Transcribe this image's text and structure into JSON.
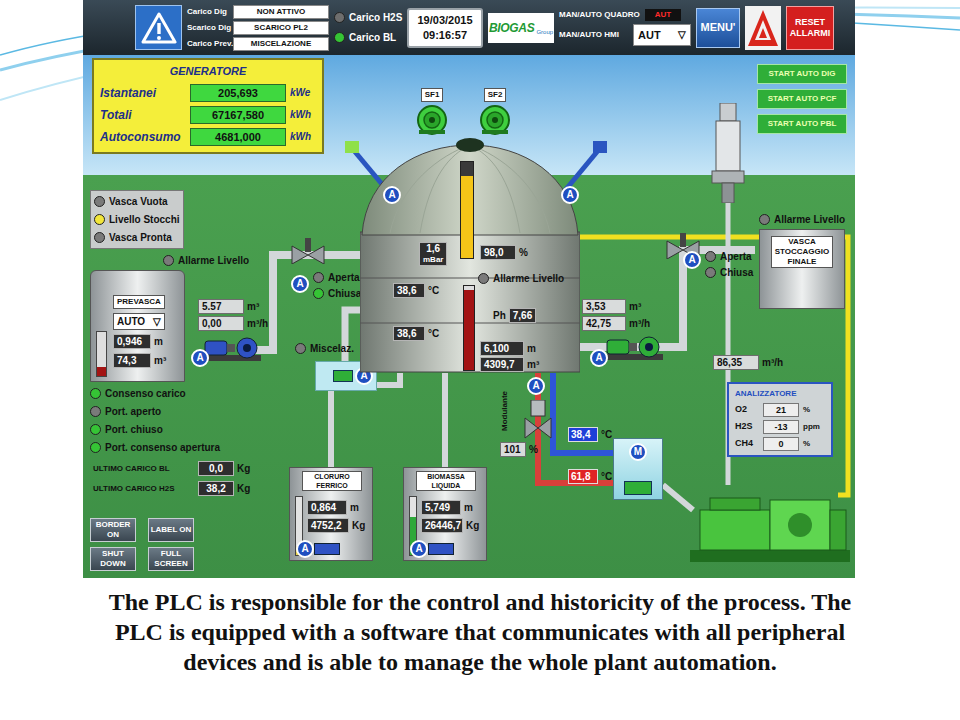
{
  "header": {
    "status_rows": [
      {
        "label": "Carico Dig",
        "value": "NON ATTIVO"
      },
      {
        "label": "Scarico Dig",
        "value": "SCARICO PL2"
      },
      {
        "label": "Carico Prev.",
        "value": "MISCELAZIONE"
      }
    ],
    "indicators": [
      {
        "label": "Carico H2S",
        "color": "#6e6e6e"
      },
      {
        "label": "Carico BL",
        "color": "#35c435"
      }
    ],
    "date": "19/03/2015",
    "time": "09:16:57",
    "logo": {
      "main": "BIOGAS",
      "sub": "Group"
    },
    "quadro": {
      "label": "MAN/AUTO QUADRO",
      "value": "AUT"
    },
    "hmi": {
      "label": "MAN/AUTO HMI",
      "value": "AUT",
      "arrow": "▽"
    },
    "menu": "MENU'",
    "reset": "RESET ALLARMI"
  },
  "generator": {
    "title": "GENERATORE",
    "rows": [
      {
        "label": "Istantanei",
        "value": "205,693",
        "unit": "kWe"
      },
      {
        "label": "Totali",
        "value": "67167,580",
        "unit": "kWh"
      },
      {
        "label": "Autoconsumo",
        "value": "4681,000",
        "unit": "kWh"
      }
    ]
  },
  "start_buttons": [
    "START AUTO DIG",
    "START AUTO PCF",
    "START AUTO PBL"
  ],
  "tank_status": [
    {
      "label": "Vasca Vuota",
      "color": "#7a7a7a"
    },
    {
      "label": "Livello Stocchi",
      "color": "#f2e63a"
    },
    {
      "label": "Vasca Pronta",
      "color": "#7a7a7a"
    }
  ],
  "prevasca": {
    "alarm": {
      "label": "Allarme Livello",
      "color": "#7a7a7a"
    },
    "name": "PREVASCA",
    "mode": "AUTO",
    "mode_arrow": "▽",
    "volume": {
      "value": "5.57",
      "unit": "m³"
    },
    "flow": {
      "value": "0,00",
      "unit": "m³/h"
    },
    "height": {
      "value": "0,946",
      "unit": "m"
    },
    "contents": {
      "value": "74,3",
      "unit": "m³"
    },
    "level": 0.2,
    "pump_badge": "A"
  },
  "inlet_valve": {
    "badge": "A",
    "states": [
      {
        "label": "Aperta",
        "color": "#7a7a7a"
      },
      {
        "label": "Chiusa",
        "color": "#35c435"
      }
    ]
  },
  "mixer": {
    "label": "Miscelaz.",
    "color": "#7a7a7a",
    "badge": "A"
  },
  "digester": {
    "fans": [
      "SF1",
      "SF2"
    ],
    "agitator_badges": [
      "A",
      "A"
    ],
    "pressure": {
      "value": "1,6",
      "unit": "mBar"
    },
    "gas": {
      "value": "98,0",
      "unit": "%"
    },
    "gas_level": 0.85,
    "temperatures": [
      {
        "value": "38,6",
        "unit": "°C"
      },
      {
        "value": "38,6",
        "unit": "°C"
      }
    ],
    "alarm": {
      "label": "Allarme Livello",
      "color": "#7a7a7a"
    },
    "ph": {
      "label": "Ph",
      "value": "7,66"
    },
    "height": {
      "value": "6,100",
      "unit": "m"
    },
    "contents": {
      "value": "4309,7",
      "unit": "m³"
    },
    "liquid_level": 0.95
  },
  "outlet": {
    "volume": {
      "value": "3,53",
      "unit": "m³"
    },
    "flow": {
      "value": "42,75",
      "unit": "m³/h"
    },
    "pump_badge": "A"
  },
  "storage_valve": {
    "badge": "A",
    "states": [
      {
        "label": "Aperta",
        "color": "#7a7a7a"
      },
      {
        "label": "Chiusa",
        "color": "#7a7a7a"
      }
    ]
  },
  "storage": {
    "alarm": {
      "label": "Allarme Livello",
      "color": "#7a7a7a"
    },
    "name": "VASCA STOCCAGGIO FINALE"
  },
  "gas_flow": {
    "value": "86,35",
    "unit": "m³/h"
  },
  "analyzer": {
    "title": "ANALIZZATORE",
    "rows": [
      {
        "label": "O2",
        "value": "21",
        "unit": "%"
      },
      {
        "label": "H2S",
        "value": "-13",
        "unit": "ppm"
      },
      {
        "label": "CH4",
        "value": "0",
        "unit": "%"
      }
    ]
  },
  "heating": {
    "valve_label": "Modulante",
    "badge": "A",
    "opening": {
      "value": "101",
      "unit": "%"
    },
    "supply": {
      "value": "38,4",
      "unit": "°C",
      "color": "#1e3fd8"
    },
    "return": {
      "value": "61,8",
      "unit": "°C",
      "color": "#e02424"
    },
    "exchanger_badge": "M"
  },
  "load_status": [
    {
      "label": "Consenso carico",
      "color": "#35c435"
    },
    {
      "label": "Port. aperto",
      "color": "#7a7a7a"
    },
    {
      "label": "Port. chiuso",
      "color": "#35c435"
    },
    {
      "label": "Port. consenso apertura",
      "color": "#35c435"
    }
  ],
  "last_loads": [
    {
      "label": "ULTIMO CARICO BL",
      "value": "0,0",
      "unit": "Kg"
    },
    {
      "label": "ULTIMO CARICO H2S",
      "value": "38,2",
      "unit": "Kg"
    }
  ],
  "buttons": [
    "BORDER ON",
    "LABEL ON",
    "SHUT DOWN",
    "FULL SCREEN"
  ],
  "dosing_tanks": [
    {
      "name": "CLORURO FERRICO",
      "height": {
        "value": "0,864",
        "unit": "m"
      },
      "weight": {
        "value": "4752,2",
        "unit": "Kg"
      },
      "level": 0.15,
      "color": "#e6d24a",
      "badge": "A"
    },
    {
      "name": "BIOMASSA LIQUIDA",
      "height": {
        "value": "5,749",
        "unit": "m"
      },
      "weight": {
        "value": "26446,7",
        "unit": "Kg"
      },
      "level": 0.65,
      "color": "#2ea83a",
      "badge": "A"
    }
  ],
  "caption": "The PLC is responsible for the control and historicity of the process. The PLC is equipped with a software that communicates with all peripheral devices and is able to manage the whole plant automation."
}
